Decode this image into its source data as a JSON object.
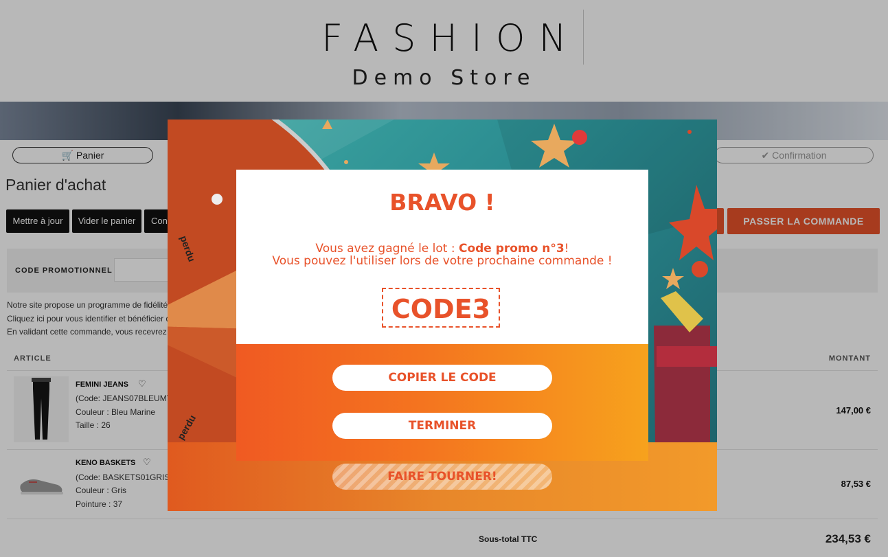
{
  "header": {
    "logo_main": "FASHION",
    "logo_sub": "Demo Store"
  },
  "steps": {
    "cart": "Panier",
    "confirmation": "Confirmation"
  },
  "page_title": "Panier d'achat",
  "toolbar": {
    "update": "Mettre à jour",
    "empty": "Vider le panier",
    "continue_partial": "Con",
    "order": "PASSER LA COMMANDE"
  },
  "promo": {
    "label": "CODE PROMOTIONNEL :"
  },
  "loyalty_lines": [
    "Notre site propose un programme de fidélité",
    "Cliquez ici pour vous identifier et bénéficier d",
    "En validant cette commande, vous recevrez"
  ],
  "table": {
    "col_article": "ARTICLE",
    "col_amount": "MONTANT"
  },
  "products": [
    {
      "name": "FEMINI JEANS",
      "code": "(Code: JEANS07BLEUMT",
      "attr1": "Couleur : Bleu Marine",
      "attr2": "Taille : 26",
      "amount": "147,00 €"
    },
    {
      "name": "KENO BASKETS",
      "code": "(Code: BASKETS01GRIST",
      "attr1": "Couleur : Gris",
      "attr2": "Pointure : 37",
      "amount": "87,53 €"
    }
  ],
  "subtotal": {
    "label": "Sous-total TTC",
    "value": "234,53 €"
  },
  "wheel": {
    "segment_label": "perdu",
    "spin_button": "FAIRE TOURNER!"
  },
  "modal": {
    "title": "BRAVO !",
    "msg_prefix": "Vous avez gagné le lot : ",
    "prize": "Code promo n°3",
    "msg_suffix": "!",
    "msg_line2": "Vous pouvez l'utiliser lors de votre prochaine commande !",
    "code": "CODE3",
    "copy_button": "COPIER LE CODE",
    "finish_button": "TERMINER"
  },
  "colors": {
    "accent": "#e8522a",
    "gradient_start": "#f05a22",
    "gradient_end": "#f7a21d"
  }
}
